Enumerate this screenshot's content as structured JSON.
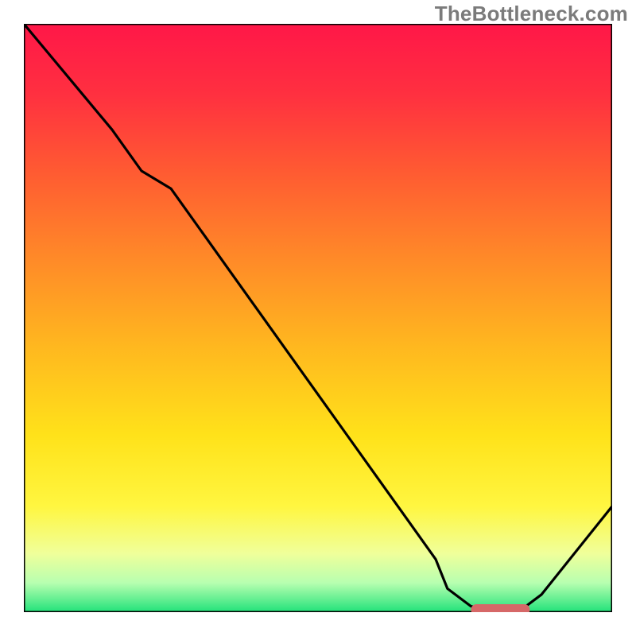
{
  "branding": {
    "watermark": "TheBottleneck.com"
  },
  "chart_data": {
    "type": "line",
    "title": "",
    "xlabel": "",
    "ylabel": "",
    "xlim": [
      0,
      100
    ],
    "ylim": [
      0,
      100
    ],
    "grid": false,
    "series": [
      {
        "name": "bottleneck-curve",
        "x": [
          0,
          5,
          10,
          15,
          20,
          25,
          30,
          35,
          40,
          45,
          50,
          55,
          60,
          65,
          70,
          72,
          76,
          80,
          84,
          88,
          92,
          96,
          100
        ],
        "y": [
          100,
          94,
          88,
          82,
          75,
          72,
          65,
          58,
          51,
          44,
          37,
          30,
          23,
          16,
          9,
          4,
          1,
          0,
          0,
          3,
          8,
          13,
          18
        ]
      }
    ],
    "highlight": {
      "name": "optimal-range",
      "x_start": 76,
      "x_end": 86,
      "y": 0
    },
    "background_gradient": {
      "stops": [
        {
          "offset": 0.0,
          "color": "#ff1748"
        },
        {
          "offset": 0.12,
          "color": "#ff3040"
        },
        {
          "offset": 0.25,
          "color": "#ff5a32"
        },
        {
          "offset": 0.4,
          "color": "#ff8a28"
        },
        {
          "offset": 0.55,
          "color": "#ffb81f"
        },
        {
          "offset": 0.7,
          "color": "#ffe21a"
        },
        {
          "offset": 0.82,
          "color": "#fff640"
        },
        {
          "offset": 0.9,
          "color": "#f0ff9a"
        },
        {
          "offset": 0.95,
          "color": "#b8ffb0"
        },
        {
          "offset": 1.0,
          "color": "#22e27a"
        }
      ]
    }
  }
}
